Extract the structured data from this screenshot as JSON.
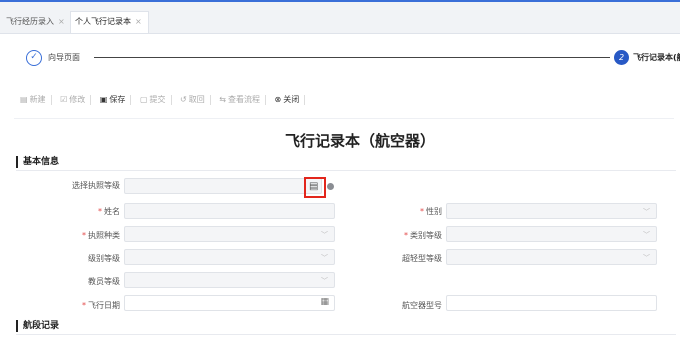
{
  "tabs": [
    {
      "label": "飞行经历录入",
      "close": "×"
    },
    {
      "label": "个人飞行记录本",
      "close": "×"
    }
  ],
  "steps": {
    "step1": {
      "icon": "check-icon",
      "glyph": "✓",
      "label": "向导页面"
    },
    "step2": {
      "number": "2",
      "label": "飞行记录本(航"
    }
  },
  "toolbar": {
    "new": {
      "icon": "new-icon",
      "glyph": "▤",
      "label": "新建"
    },
    "edit": {
      "icon": "edit-icon",
      "glyph": "☑",
      "label": "修改"
    },
    "save": {
      "icon": "save-icon",
      "glyph": "▣",
      "label": "保存"
    },
    "submit": {
      "icon": "submit-icon",
      "glyph": "▢",
      "label": "提交"
    },
    "withdraw": {
      "icon": "withdraw-icon",
      "glyph": "↺",
      "label": "取回"
    },
    "track": {
      "icon": "track-icon",
      "glyph": "⇆",
      "label": "查看流程"
    },
    "close": {
      "icon": "close-circle-icon",
      "glyph": "⊗",
      "label": "关闭"
    }
  },
  "title": "飞行记录本（航空器）",
  "sections": {
    "basic": "基本信息",
    "segment": "航段记录"
  },
  "form": {
    "license_level": {
      "label": "选择执照等级",
      "value": "",
      "picker_glyph": "▤"
    },
    "name": {
      "label": "姓名",
      "required": "*",
      "value": ""
    },
    "gender": {
      "label": "性别",
      "required": "*",
      "value": "",
      "chevron": "﹀"
    },
    "license_type": {
      "label": "执照种类",
      "required": "*",
      "value": "",
      "chevron": "﹀"
    },
    "category_level": {
      "label": "类别等级",
      "required": "*",
      "value": "",
      "chevron": "﹀"
    },
    "class_level": {
      "label": "级别等级",
      "value": "",
      "chevron": "﹀"
    },
    "ultralight_level": {
      "label": "超轻型等级",
      "value": "",
      "chevron": "﹀"
    },
    "instructor_level": {
      "label": "教员等级",
      "value": "",
      "chevron": "﹀"
    },
    "flight_date": {
      "label": "飞行日期",
      "required": "*",
      "value": "",
      "calendar_glyph": "▦"
    },
    "aircraft_model": {
      "label": "航空器型号",
      "value": ""
    }
  }
}
